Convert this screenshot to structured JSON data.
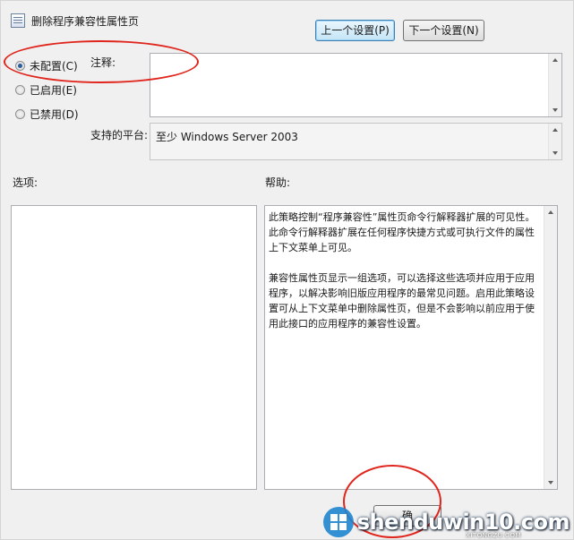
{
  "window": {
    "title": "删除程序兼容性属性页"
  },
  "nav": {
    "prev_label": "上一个设置(P)",
    "next_label": "下一个设置(N)"
  },
  "state_options": [
    {
      "label": "未配置(C)",
      "checked": true
    },
    {
      "label": "已启用(E)",
      "checked": false
    },
    {
      "label": "已禁用(D)",
      "checked": false
    }
  ],
  "comment": {
    "label": "注释:",
    "value": ""
  },
  "platform": {
    "label": "支持的平台:",
    "value": "至少 Windows Server 2003"
  },
  "options_section": {
    "label": "选项:"
  },
  "help_section": {
    "label": "帮助:",
    "paragraphs": [
      "此策略控制“程序兼容性”属性页命令行解释器扩展的可见性。此命令行解释器扩展在任何程序快捷方式或可执行文件的属性上下文菜单上可见。",
      "兼容性属性页显示一组选项，可以选择这些选项并应用于应用程序，以解决影响旧版应用程序的最常见问题。启用此策略设置可从上下文菜单中删除属性页，但是不会影响以前应用于使用此接口的应用程序的兼容性设置。"
    ]
  },
  "footer": {
    "ok_label_partial": "确"
  },
  "watermark": {
    "text": "shenduwin10.com",
    "sub": "XITONGZU.COM"
  },
  "colors": {
    "annotation": "#e0251d",
    "accent": "#3c7fb1"
  }
}
